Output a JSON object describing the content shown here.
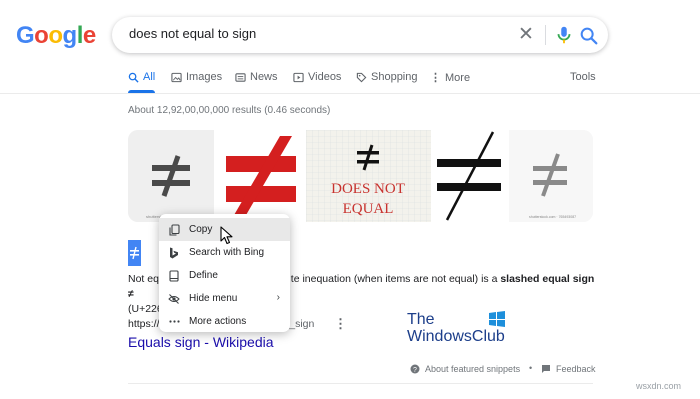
{
  "logo": {
    "letters": [
      {
        "ch": "G",
        "color": "#4285F4"
      },
      {
        "ch": "o",
        "color": "#EA4335"
      },
      {
        "ch": "o",
        "color": "#FBBC05"
      },
      {
        "ch": "g",
        "color": "#4285F4"
      },
      {
        "ch": "l",
        "color": "#34A853"
      },
      {
        "ch": "e",
        "color": "#EA4335"
      }
    ]
  },
  "search": {
    "query": "does not equal to sign"
  },
  "tabs": {
    "all": "All",
    "images": "Images",
    "news": "News",
    "videos": "Videos",
    "shopping": "Shopping",
    "more": "More",
    "tools": "Tools"
  },
  "result_stats": "About 12,92,00,00,000 results (0.46 seconds)",
  "images": {
    "img3_text_1": "DOES NOT",
    "img3_text_2": "EQUAL",
    "img1_caption": "shutterstock",
    "img5_caption": "shutterstock.com · 765493087"
  },
  "snippet": {
    "text_a": "Not equ",
    "text_b": "te inequation (when items are not equal) is a ",
    "text_bold": "slashed equal sign ≠",
    "text_c": "(U+226",
    "cite_left": "https://",
    "cite_right": "s_sign",
    "cite_more": "⋮",
    "link": "Equals sign - Wikipedia"
  },
  "context_menu": {
    "items": [
      {
        "label": "Copy",
        "icon": "copy-icon"
      },
      {
        "label": "Search with Bing",
        "icon": "bing-icon"
      },
      {
        "label": "Define",
        "icon": "book-icon"
      },
      {
        "label": "Hide menu",
        "icon": "eye-off-icon"
      },
      {
        "label": "More actions",
        "icon": "more-horizontal-icon"
      }
    ],
    "submenu_arrow": "›"
  },
  "watermark_logo": {
    "line1": "The",
    "line2": "WindowsClub"
  },
  "footer": {
    "featured": "About featured snippets",
    "dot": "•",
    "feedback": "Feedback"
  },
  "site_watermark": "wsxdn.com",
  "colors": {
    "link": "#1a0dab",
    "accent": "#1a73e8",
    "red_sign": "#d41f1f"
  }
}
